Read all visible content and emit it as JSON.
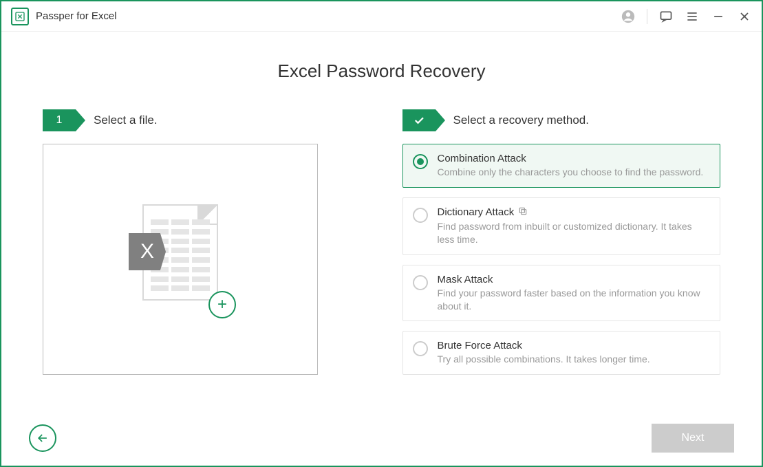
{
  "app": {
    "title": "Passper for Excel"
  },
  "page": {
    "title": "Excel Password Recovery"
  },
  "step1": {
    "number": "1",
    "label": "Select a file."
  },
  "step2": {
    "label": "Select a recovery method."
  },
  "methods": [
    {
      "title": "Combination Attack",
      "desc": "Combine only the characters you choose to find the password.",
      "selected": true,
      "copy": false
    },
    {
      "title": "Dictionary Attack",
      "desc": "Find password from inbuilt or customized dictionary. It takes less time.",
      "selected": false,
      "copy": true
    },
    {
      "title": "Mask Attack",
      "desc": "Find your password faster based on the information you know about it.",
      "selected": false,
      "copy": false
    },
    {
      "title": "Brute Force Attack",
      "desc": "Try all possible combinations. It takes longer time.",
      "selected": false,
      "copy": false
    }
  ],
  "footer": {
    "next": "Next"
  }
}
